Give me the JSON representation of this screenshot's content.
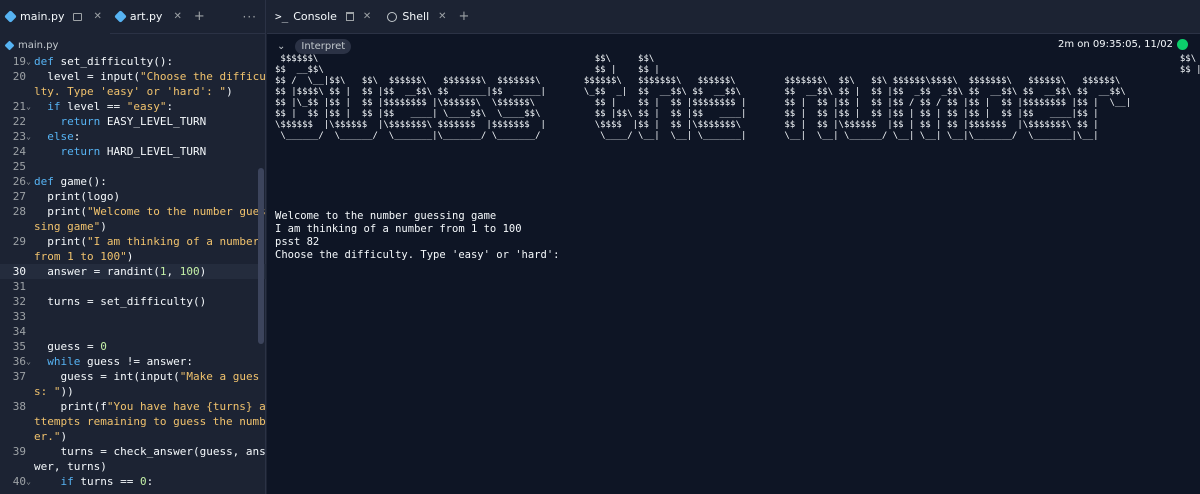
{
  "editor": {
    "tabs": [
      {
        "label": "main.py"
      },
      {
        "label": "art.py"
      }
    ],
    "tab_plus": "+",
    "tab_more": "···",
    "breadcrumb": "main.py",
    "lines": [
      {
        "n": "19",
        "fold": true,
        "parts": [
          [
            "kw",
            "def "
          ],
          [
            "fn",
            "set_difficulty():"
          ]
        ]
      },
      {
        "n": "20",
        "fold": false,
        "parts": [
          [
            "op",
            "  level = "
          ],
          [
            "fn",
            "input("
          ],
          [
            "str",
            "\"Choose the difficulty. Type 'easy' or 'hard': \""
          ],
          [
            "op",
            ")"
          ]
        ]
      },
      {
        "n": "21",
        "fold": true,
        "parts": [
          [
            "op",
            "  "
          ],
          [
            "kw",
            "if"
          ],
          [
            "op",
            " level == "
          ],
          [
            "str",
            "\"easy\""
          ],
          [
            "op",
            ":"
          ]
        ]
      },
      {
        "n": "22",
        "fold": false,
        "parts": [
          [
            "op",
            "    "
          ],
          [
            "kw",
            "return"
          ],
          [
            "op",
            " EASY_LEVEL_TURN"
          ]
        ]
      },
      {
        "n": "23",
        "fold": true,
        "parts": [
          [
            "op",
            "  "
          ],
          [
            "kw",
            "else"
          ],
          [
            "op",
            ":"
          ]
        ]
      },
      {
        "n": "24",
        "fold": false,
        "parts": [
          [
            "op",
            "    "
          ],
          [
            "kw",
            "return"
          ],
          [
            "op",
            " HARD_LEVEL_TURN"
          ]
        ]
      },
      {
        "n": "25",
        "fold": false,
        "parts": []
      },
      {
        "n": "26",
        "fold": true,
        "parts": [
          [
            "kw",
            "def "
          ],
          [
            "fn",
            "game():"
          ]
        ]
      },
      {
        "n": "27",
        "fold": false,
        "parts": [
          [
            "op",
            "  print(logo)"
          ]
        ]
      },
      {
        "n": "28",
        "fold": false,
        "parts": [
          [
            "op",
            "  print("
          ],
          [
            "str",
            "\"Welcome to the number guessing game\""
          ],
          [
            "op",
            ")"
          ]
        ]
      },
      {
        "n": "29",
        "fold": false,
        "parts": [
          [
            "op",
            "  print("
          ],
          [
            "str",
            "\"I am thinking of a number from 1 to 100\""
          ],
          [
            "op",
            ")"
          ]
        ]
      },
      {
        "n": "30",
        "fold": false,
        "current": true,
        "parts": [
          [
            "op",
            "  answer = randint("
          ],
          [
            "num",
            "1"
          ],
          [
            "op",
            ", "
          ],
          [
            "num",
            "100"
          ],
          [
            "op",
            ")"
          ]
        ]
      },
      {
        "n": "31",
        "fold": false,
        "parts": []
      },
      {
        "n": "32",
        "fold": false,
        "parts": [
          [
            "op",
            "  turns = set_difficulty()"
          ]
        ]
      },
      {
        "n": "33",
        "fold": false,
        "parts": []
      },
      {
        "n": "34",
        "fold": false,
        "parts": []
      },
      {
        "n": "35",
        "fold": false,
        "parts": [
          [
            "op",
            "  guess = "
          ],
          [
            "num",
            "0"
          ]
        ]
      },
      {
        "n": "36",
        "fold": true,
        "parts": [
          [
            "op",
            "  "
          ],
          [
            "kw",
            "while"
          ],
          [
            "op",
            " guess != answer:"
          ]
        ]
      },
      {
        "n": "37",
        "fold": false,
        "parts": [
          [
            "op",
            "    guess = int(input("
          ],
          [
            "str",
            "\"Make a guess: \""
          ],
          [
            "op",
            "))"
          ]
        ]
      },
      {
        "n": "38",
        "fold": false,
        "parts": [
          [
            "op",
            "    print(f"
          ],
          [
            "str",
            "\"You have have {turns} attempts remaining to guess the number.\""
          ],
          [
            "op",
            ")"
          ]
        ]
      },
      {
        "n": "39",
        "fold": false,
        "parts": [
          [
            "op",
            "    turns = check_answer(guess, answer, turns)"
          ]
        ]
      },
      {
        "n": "40",
        "fold": true,
        "parts": [
          [
            "op",
            "    "
          ],
          [
            "kw",
            "if"
          ],
          [
            "op",
            " turns == "
          ],
          [
            "num",
            "0"
          ],
          [
            "op",
            ":"
          ]
        ]
      }
    ]
  },
  "console": {
    "tabs": [
      {
        "label": "Console"
      },
      {
        "label": "Shell"
      }
    ],
    "tab_plus": "+",
    "interpreter_label": "Interpret",
    "run_info": "2m on 09:35:05, 11/02",
    "ascii_logo": " $$$$$$\\                                                   $$\\     $$\\                                                                                                 $$\\\n$$  __$$\\                                                  $$ |    $$ |                                                                                                $$ |\n$$ /  \\__|$$\\   $$\\  $$$$$$\\   $$$$$$$\\  $$$$$$$\\        $$$$$$\\   $$$$$$$\\   $$$$$$\\         $$$$$$$\\  $$\\   $$\\ $$$$$$\\$$$$\\  $$$$$$$\\   $$$$$$\\   $$$$$$\\\n$$ |$$$$\\ $$ |  $$ |$$  __$$\\ $$  _____|$$  _____|       \\_$$  _|  $$  __$$\\ $$  __$$\\        $$  __$$\\ $$ |  $$ |$$  _$$  _$$\\ $$  __$$\\ $$  __$$\\ $$  __$$\\\n$$ |\\_$$ |$$ |  $$ |$$$$$$$$ |\\$$$$$$\\  \\$$$$$$\\           $$ |    $$ |  $$ |$$$$$$$$ |       $$ |  $$ |$$ |  $$ |$$ / $$ / $$ |$$ |  $$ |$$$$$$$$ |$$ |  \\__|\n$$ |  $$ |$$ |  $$ |$$   ____| \\____$$\\  \\____$$\\          $$ |$$\\ $$ |  $$ |$$   ____|       $$ |  $$ |$$ |  $$ |$$ | $$ | $$ |$$ |  $$ |$$   ____|$$ |\n\\$$$$$$  |\\$$$$$$  |\\$$$$$$$\\ $$$$$$$  |$$$$$$$  |         \\$$$$  |$$ |  $$ |\\$$$$$$$\\        $$ |  $$ |\\$$$$$$  |$$ | $$ | $$ |$$$$$$$  |\\$$$$$$$\\ $$ |\n \\______/  \\______/  \\_______|\\_______/ \\_______/           \\____/ \\__|  \\__| \\_______|       \\__|  \\__| \\______/ \\__| \\__| \\__|\\_______/  \\_______|\\__|",
    "output_lines": [
      "Welcome to the number guessing game",
      "I am thinking of a number from 1 to 100",
      "psst 82",
      "Choose the difficulty. Type 'easy' or 'hard':"
    ]
  },
  "colors": {
    "editor_bg": "#1c2333",
    "console_bg": "#0e1525",
    "keyword": "#56b3f3",
    "string": "#f0c26d",
    "number": "#c4f0a7",
    "status_ok": "#0cce6b"
  }
}
